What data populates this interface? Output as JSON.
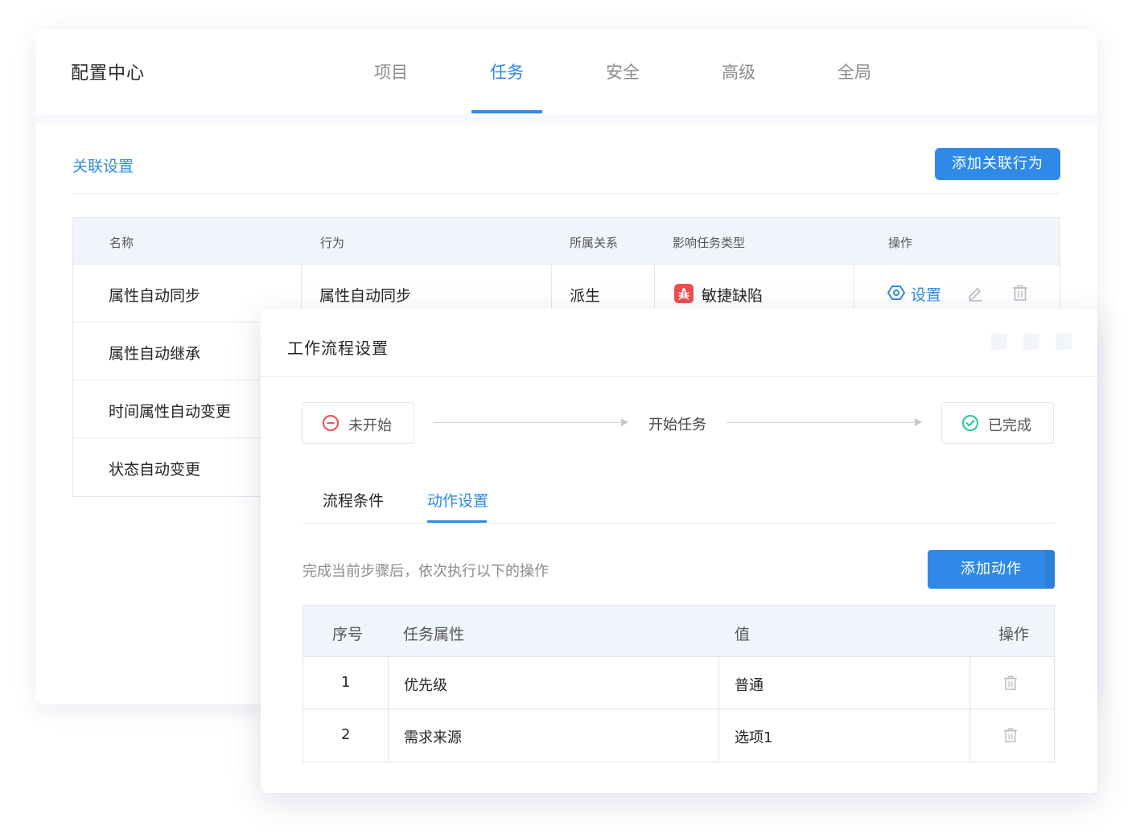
{
  "header": {
    "app_title": "配置中心",
    "tabs": [
      {
        "label": "项目",
        "active": false
      },
      {
        "label": "任务",
        "active": true
      },
      {
        "label": "安全",
        "active": false
      },
      {
        "label": "高级",
        "active": false
      },
      {
        "label": "全局",
        "active": false
      }
    ]
  },
  "colors": {
    "accent": "#2e8ae6",
    "bug_badge": "#f04d4d",
    "not_started": "#f04d4d",
    "done": "#23c6a0"
  },
  "association": {
    "section_title": "关联设置",
    "add_button": "添加关联行为",
    "columns": [
      "名称",
      "行为",
      "所属关系",
      "影响任务类型",
      "操作"
    ],
    "rows": [
      {
        "name": "属性自动同步",
        "behavior": "属性自动同步",
        "relation": "派生",
        "task_type": "敏捷缺陷",
        "task_type_icon": "bug-icon",
        "action_label": "设置"
      },
      {
        "name": "属性自动继承"
      },
      {
        "name": "时间属性自动变更"
      },
      {
        "name": "状态自动变更"
      }
    ]
  },
  "modal": {
    "title": "工作流程设置",
    "flow": {
      "from": {
        "label": "未开始",
        "icon": "minus-circle-icon"
      },
      "transition": "开始任务",
      "to": {
        "label": "已完成",
        "icon": "check-circle-icon"
      }
    },
    "sub_tabs": [
      {
        "label": "流程条件",
        "active": false
      },
      {
        "label": "动作设置",
        "active": true
      }
    ],
    "hint": "完成当前步骤后，依次执行以下的操作",
    "add_action_button": "添加动作",
    "columns": [
      "序号",
      "任务属性",
      "值",
      "操作"
    ],
    "rows": [
      {
        "index": "1",
        "attribute": "优先级",
        "value": "普通"
      },
      {
        "index": "2",
        "attribute": "需求来源",
        "value": "选项1"
      }
    ]
  }
}
